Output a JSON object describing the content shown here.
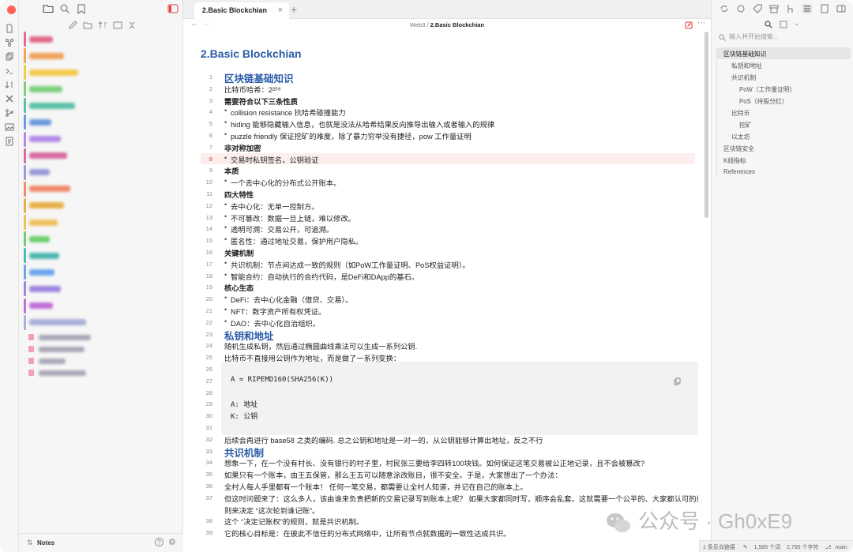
{
  "tab": {
    "title": "2.Basic Blockchian"
  },
  "breadcrumb": {
    "folder": "Web3",
    "sep": " / ",
    "current": "2.Basic Blockchian"
  },
  "doc": {
    "title": "2.Basic Blockchian"
  },
  "lines": [
    {
      "n": "1",
      "t": "区块链基础知识",
      "k": "h"
    },
    {
      "n": "2",
      "t": "比特币哈希：2²⁵⁶",
      "k": ""
    },
    {
      "n": "3",
      "t": "需要符合以下三条性质",
      "k": "b"
    },
    {
      "n": "4",
      "t": "collision resistance 抗哈希碰撞能力",
      "k": "li"
    },
    {
      "n": "5",
      "t": "hiding 能够隐藏输入信息，也就是没法从哈希结果反向推导出输入或者输入的规律",
      "k": "li"
    },
    {
      "n": "6",
      "t": "puzzle friendly 保证挖矿的难度，除了暴力穷举没有捷径，pow 工作量证明",
      "k": "li"
    },
    {
      "n": "7",
      "t": "非对称加密",
      "k": "b"
    },
    {
      "n": "8",
      "t": "交易时私钥签名，公钥验证",
      "k": "li hl"
    },
    {
      "n": "9",
      "t": "本质",
      "k": "b"
    },
    {
      "n": "10",
      "t": "一个去中心化的分布式公开账本。",
      "k": "li"
    },
    {
      "n": "11",
      "t": "四大特性",
      "k": "b"
    },
    {
      "n": "12",
      "t": "去中心化：无单一控制方。",
      "k": "li"
    },
    {
      "n": "13",
      "t": "不可篡改：数据一旦上链，难以修改。",
      "k": "li"
    },
    {
      "n": "14",
      "t": "透明可溯：交易公开，可追溯。",
      "k": "li"
    },
    {
      "n": "15",
      "t": "匿名性：通过地址交易，保护用户隐私。",
      "k": "li"
    },
    {
      "n": "16",
      "t": "关键机制",
      "k": "b"
    },
    {
      "n": "17",
      "t": "共识机制：节点间达成一致的规则（如PoW工作量证明、PoS权益证明）。",
      "k": "li"
    },
    {
      "n": "18",
      "t": "智能合约：自动执行的合约代码，是DeFi和DApp的基石。",
      "k": "li"
    },
    {
      "n": "19",
      "t": "核心生态",
      "k": "b"
    },
    {
      "n": "20",
      "t": "DeFi：去中心化金融（借贷、交易）。",
      "k": "li"
    },
    {
      "n": "21",
      "t": "NFT：数字资产所有权凭证。",
      "k": "li"
    },
    {
      "n": "22",
      "t": "DAO：去中心化自治组织。",
      "k": "li"
    },
    {
      "n": "23",
      "t": "私钥和地址",
      "k": "h"
    },
    {
      "n": "24",
      "t": "随机生成私钥，然后通过椭圆曲线乘法可以生成一系列公钥.",
      "k": ""
    },
    {
      "n": "25",
      "t": "比特币不直接用公钥作为地址，而是做了一系列变换：",
      "k": ""
    },
    {
      "n": "26",
      "t": "",
      "k": "code"
    },
    {
      "n": "27",
      "t": "A = RIPEMD160(SHA256(K))",
      "k": "code"
    },
    {
      "n": "28",
      "t": "",
      "k": "code"
    },
    {
      "n": "29",
      "t": "A: 地址",
      "k": "code"
    },
    {
      "n": "30",
      "t": "K: 公钥",
      "k": "code"
    },
    {
      "n": "31",
      "t": "",
      "k": "code"
    },
    {
      "n": "32",
      "t": "后续会再进行 base58 之类的编码. 总之公钥和地址是一对一的，从公钥能够计算出地址，反之不行",
      "k": ""
    },
    {
      "n": "33",
      "t": "共识机制",
      "k": "h"
    },
    {
      "n": "34",
      "t": "想象一下，在一个没有村长、没有银行的村子里，村民张三要给李四转100块钱。如何保证这笔交易被公正地记录，且不会被篡改?",
      "k": ""
    },
    {
      "n": "35",
      "t": "如果只有一个账本，由王五保管，那么王五可以随意涂改账目，很不安全。于是，大家想出了一个办法：",
      "k": ""
    },
    {
      "n": "36",
      "t": "全村人每人手里都有一个账本！ 任何一笔交易，都需要让全村人知道，并记在自己的账本上。",
      "k": ""
    },
    {
      "n": "37",
      "t": "但这时问题来了：这么多人，该由谁来负责把新的交易记录写到账本上呢？ 如果大家都同时写，顺序会乱套。这就需要一个公平的、大家都认可的规",
      "k": ""
    },
    {
      "n": "",
      "t": "则来决定 “这次轮到谁记账”。",
      "k": ""
    },
    {
      "n": "38",
      "t": "这个 “决定记账权”的规则，就是共识机制。",
      "k": ""
    },
    {
      "n": "39",
      "t": "它的核心目标是：在彼此不信任的分布式网络中，让所有节点就数据的一致性达成共识。",
      "k": ""
    }
  ],
  "outline": {
    "search_placeholder": "输入并开始搜索...",
    "items": [
      {
        "label": "区块链基础知识",
        "level": 0,
        "active": true
      },
      {
        "label": "私钥和地址",
        "level": 1
      },
      {
        "label": "共识机制",
        "level": 1
      },
      {
        "label": "PoW（工作量证明）",
        "level": 2
      },
      {
        "label": "PoS（持股分红）",
        "level": 2
      },
      {
        "label": "比特币",
        "level": 1
      },
      {
        "label": "挖矿",
        "level": 2
      },
      {
        "label": "以太坊",
        "level": 1
      },
      {
        "label": "区块链安全",
        "level": 0
      },
      {
        "label": "K线指标",
        "level": 0
      },
      {
        "label": "References",
        "level": 0
      }
    ]
  },
  "sidebar": {
    "vault_name": "Notes"
  },
  "status": {
    "backlinks": "1 条反向链接",
    "words": "1,585 个词",
    "chars": "2,795 个字符",
    "branch": "main"
  },
  "watermark": "公众号 · Gh0xE9",
  "colors": {
    "accent": "#2a5ca8",
    "file_bar_colors": [
      "#e06b8b",
      "#f0a35a",
      "#f2c94c",
      "#7ecf7e",
      "#5bc0a8",
      "#6a9be0",
      "#b48ae8",
      "#d76b9e",
      "#9a9ad8",
      "#f08a6a",
      "#e8b04a",
      "#f0c060",
      "#6fcf6f",
      "#4fb8b0",
      "#6aa6e8",
      "#9e86e0",
      "#c070d8",
      "#aab0d8"
    ]
  }
}
